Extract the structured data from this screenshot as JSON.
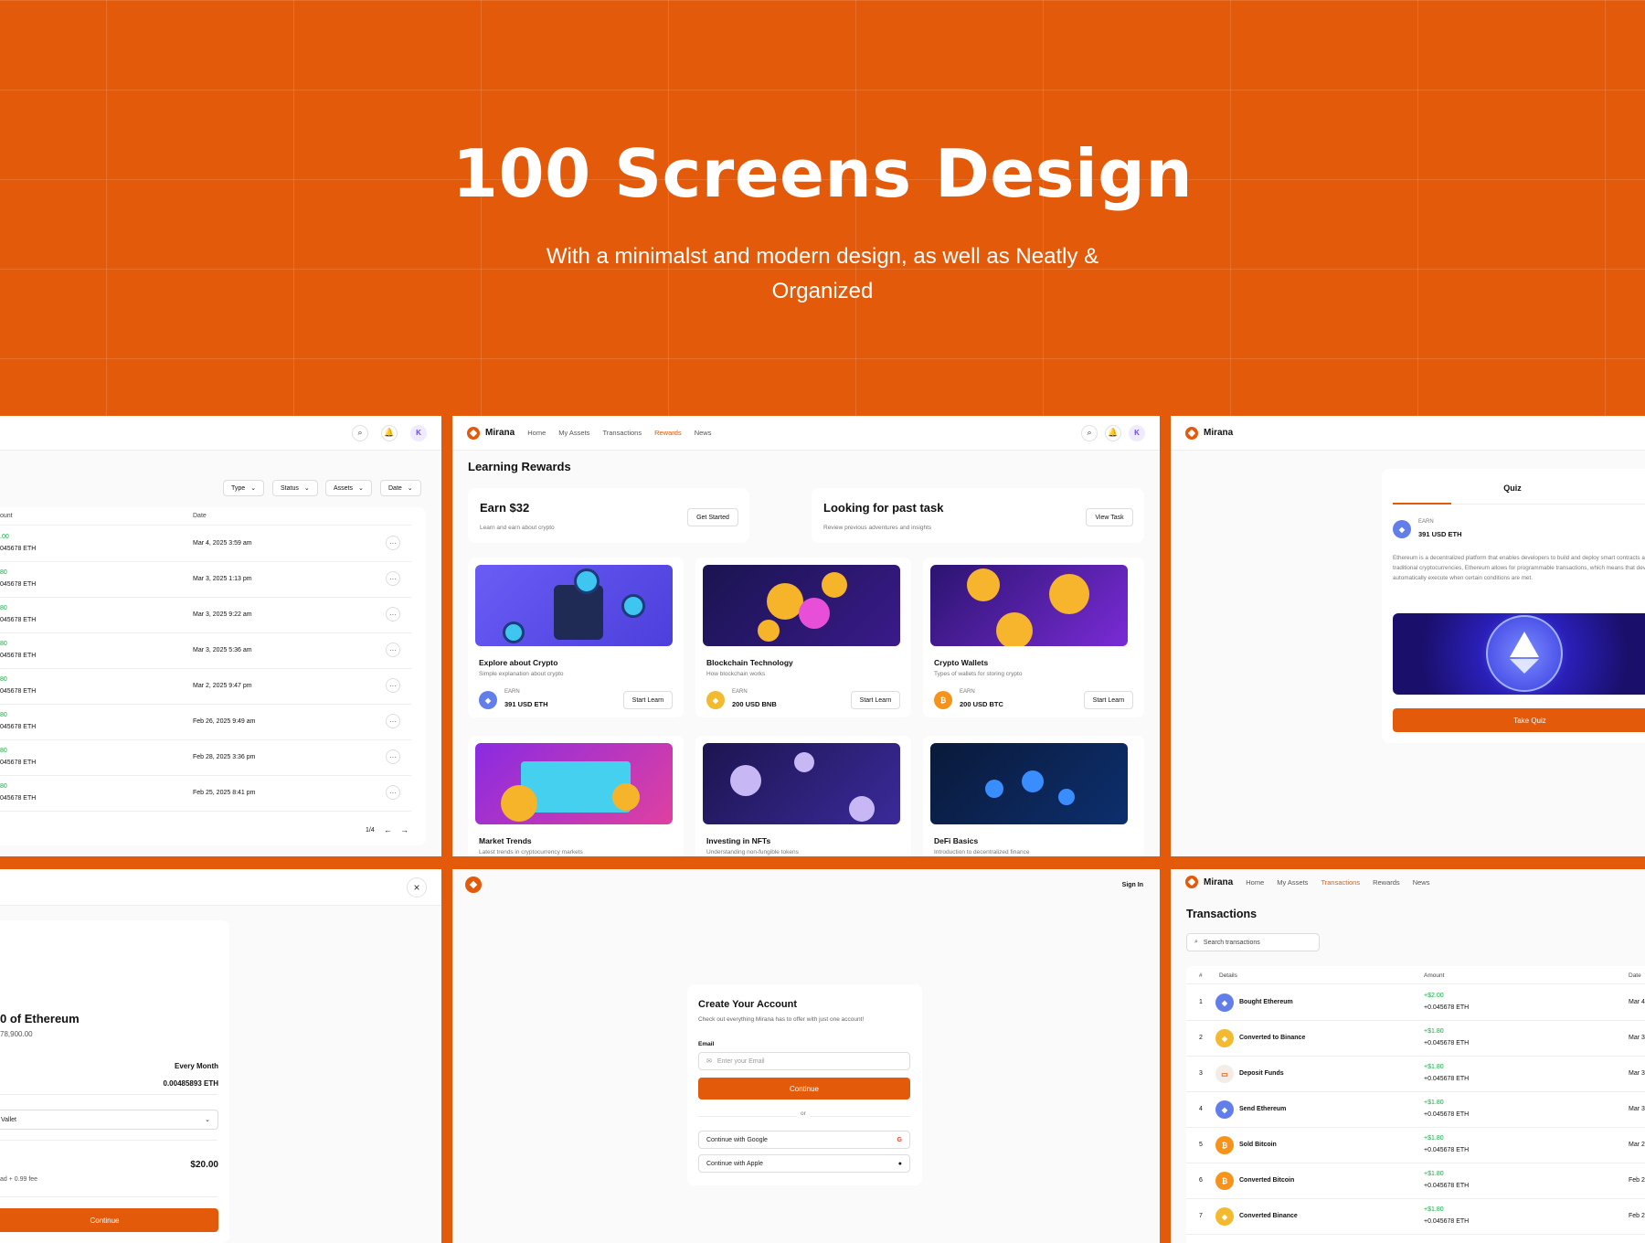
{
  "hero": {
    "title": "100 Screens Design",
    "subtitle": "With a minimalst and modern design, as well as Neatly & Organized"
  },
  "brand": {
    "name": "Mirana",
    "accent": "#E35A0A"
  },
  "nav": {
    "home": "Home",
    "assets": "My Assets",
    "transactions": "Transactions",
    "rewards": "Rewards",
    "news": "News"
  },
  "user": {
    "initial": "K"
  },
  "screen1": {
    "filters": [
      "Type",
      "Status",
      "Assets",
      "Date"
    ],
    "columns": {
      "amount": "ount",
      "date": "Date"
    },
    "rows": [
      {
        "amount": ".00",
        "eth": "045678 ETH",
        "date": "Mar 4, 2025 3:59 am"
      },
      {
        "amount": "80",
        "eth": "045678 ETH",
        "date": "Mar 3, 2025 1:13 pm"
      },
      {
        "amount": "80",
        "eth": "045678 ETH",
        "date": "Mar 3, 2025 9:22 am"
      },
      {
        "amount": "80",
        "eth": "045678 ETH",
        "date": "Mar 3, 2025 5:36 am"
      },
      {
        "amount": "80",
        "eth": "045678 ETH",
        "date": "Mar 2, 2025 9:47 pm"
      },
      {
        "amount": "80",
        "eth": "045678 ETH",
        "date": "Feb 26, 2025 9:49 am"
      },
      {
        "amount": "80",
        "eth": "045678 ETH",
        "date": "Feb 28, 2025 3:36 pm"
      },
      {
        "amount": "80",
        "eth": "045678 ETH",
        "date": "Feb 25, 2025 8:41 pm"
      }
    ],
    "pagination": "1/4"
  },
  "screen2": {
    "title": "Learning Rewards",
    "earn": {
      "title": "Earn $32",
      "desc": "Learn and earn about crypto",
      "button": "Get Started"
    },
    "past": {
      "title": "Looking for past task",
      "desc": "Review previous adventures and insights",
      "button": "View Task"
    },
    "courses": [
      {
        "title": "Explore about Crypto",
        "desc": "Simple explanation about crypto",
        "earn_label": "EARN",
        "earn": "391 USD ETH",
        "coin": "eth",
        "button": "Start Learn"
      },
      {
        "title": "Blockchain Technology",
        "desc": "How blockchain works",
        "earn_label": "EARN",
        "earn": "200 USD BNB",
        "coin": "bnb",
        "button": "Start Learn"
      },
      {
        "title": "Crypto Wallets",
        "desc": "Types of wallets for storing crypto",
        "earn_label": "EARN",
        "earn": "200 USD BTC",
        "coin": "btc",
        "button": "Start Learn"
      },
      {
        "title": "Market Trends",
        "desc": "Latest trends in cryptocurrency markets"
      },
      {
        "title": "Investing in NFTs",
        "desc": "Understanding non-fungible tokens"
      },
      {
        "title": "DeFi Basics",
        "desc": "Introduction to decentralized finance"
      }
    ]
  },
  "screen3": {
    "tab": "Quiz",
    "earn_label": "EARN",
    "earn": "391 USD ETH",
    "text": "Ethereum is a decentralized platform that enables developers to build and deploy smart contracts and decentralized applications (dApps). Unlike traditional cryptocurrencies, Ethereum allows for programmable transactions, which means that developers can create complex agreements that automatically execute when certain conditions are met.",
    "button": "Take Quiz"
  },
  "screen4": {
    "close": "×",
    "title": "0 of Ethereum",
    "subtitle": "78,900.00",
    "frequency": "Every Month",
    "amount_eth": "0.00485893 ETH",
    "wallet": "Vallet",
    "total": "$20.00",
    "fee": "ad + 0.99 fee",
    "button": "Continue"
  },
  "screen5": {
    "signin": "Sign In",
    "title": "Create Your Account",
    "desc": "Check out everything Mirana has to offer with just one account!",
    "email_label": "Email",
    "email_placeholder": "Enter your Email",
    "continue": "Continue",
    "or": "or",
    "google": "Continue with Google",
    "apple": "Continue with Apple"
  },
  "screen6": {
    "title": "Transactions",
    "search_placeholder": "Search transactions",
    "columns": {
      "num": "#",
      "details": "Details",
      "amount": "Amount",
      "date": "Date"
    },
    "rows": [
      {
        "n": "1",
        "name": "Bought Ethereum",
        "coin": "eth",
        "usd": "+$2.00",
        "eth": "+0.045678 ETH",
        "date": "Mar 4"
      },
      {
        "n": "2",
        "name": "Converted to Binance",
        "coin": "bnb",
        "usd": "+$1.80",
        "eth": "+0.045678 ETH",
        "date": "Mar 3"
      },
      {
        "n": "3",
        "name": "Deposit Funds",
        "coin": "dep",
        "usd": "+$1.80",
        "eth": "+0.045678 ETH",
        "date": "Mar 3"
      },
      {
        "n": "4",
        "name": "Send Ethereum",
        "coin": "eth",
        "usd": "+$1.80",
        "eth": "+0.045678 ETH",
        "date": "Mar 3"
      },
      {
        "n": "5",
        "name": "Sold Bitcoin",
        "coin": "btc",
        "usd": "+$1.80",
        "eth": "+0.045678 ETH",
        "date": "Mar 2"
      },
      {
        "n": "6",
        "name": "Converted Bitcoin",
        "coin": "btc",
        "usd": "+$1.80",
        "eth": "+0.045678 ETH",
        "date": "Feb 2"
      },
      {
        "n": "7",
        "name": "Converted Binance",
        "coin": "bnb",
        "usd": "+$1.80",
        "eth": "+0.045678 ETH",
        "date": "Feb 2"
      }
    ]
  }
}
